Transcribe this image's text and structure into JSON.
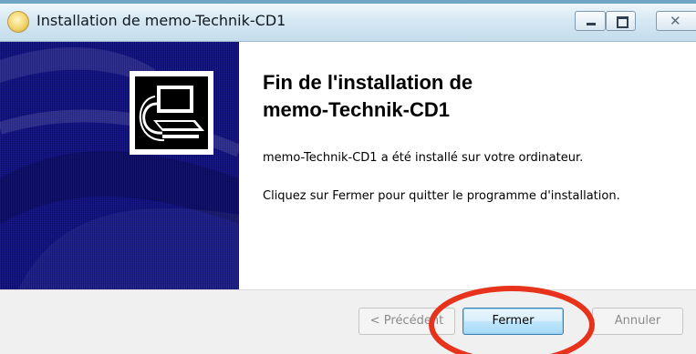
{
  "window": {
    "title": "Installation de memo-Technik-CD1",
    "controls": {
      "minimize": "minimize-icon",
      "maximize": "maximize-icon",
      "close": "✕"
    }
  },
  "content": {
    "heading_line1": "Fin de l'installation de",
    "heading_line2": "memo-Technik-CD1",
    "message_installed": "memo-Technik-CD1 a été installé sur votre ordinateur.",
    "message_instruction": "Cliquez sur Fermer pour quitter le programme d'installation."
  },
  "buttons": {
    "previous": "< Précédent",
    "close": "Fermer",
    "cancel": "Annuler"
  },
  "colors": {
    "banner": "#0a0a82",
    "highlight_annotation": "#e8331c",
    "titlebar_border": "#6fa6c6"
  }
}
